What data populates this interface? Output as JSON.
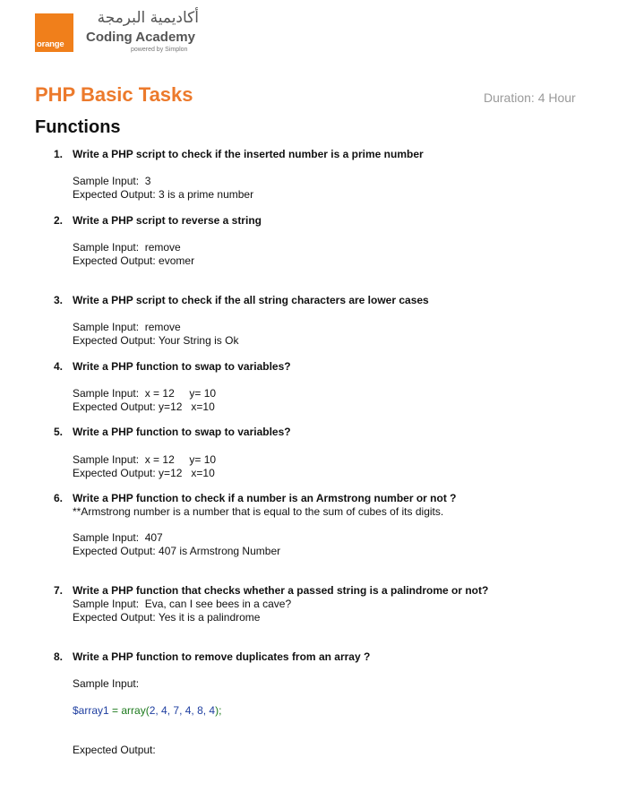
{
  "logo": {
    "badge_text": "orange",
    "arabic_name": "أكاديمية البرمجة",
    "english_name": "Coding Academy",
    "powered_by": "powered by Simplon"
  },
  "header": {
    "title": "PHP Basic Tasks",
    "duration": "Duration: 4 Hour"
  },
  "section_title": "Functions",
  "tasks": [
    {
      "num": "1.",
      "question": "Write a PHP script to check if the inserted number is a prime number",
      "input": "Sample Input:  3",
      "output": "Expected Output: 3 is a prime number"
    },
    {
      "num": "2.",
      "question": "Write a PHP script to reverse a string",
      "input": "Sample Input:  remove",
      "output": "Expected Output: evomer"
    },
    {
      "num": "3.",
      "question": " Write a PHP script to check if the all string characters are lower cases",
      "input": "Sample Input:  remove",
      "output": "Expected Output: Your String is Ok"
    },
    {
      "num": "4.",
      "question": "Write a PHP function to swap to variables?",
      "input": "Sample Input:  x = 12     y= 10",
      "output": "Expected Output: y=12   x=10"
    },
    {
      "num": "5.",
      "question": "Write a PHP function to swap to variables?",
      "input": "Sample Input:  x = 12     y= 10",
      "output": "Expected Output: y=12   x=10"
    },
    {
      "num": "6.",
      "question": "Write a PHP function to check if a number is an Armstrong number or not ?",
      "note": "**Armstrong number is a number that is equal to the sum of cubes of its digits.",
      "input": "Sample Input:  407",
      "output": "Expected Output: 407 is Armstrong Number"
    },
    {
      "num": "7.",
      "question": "Write a PHP function that checks whether a passed string is a palindrome or not?",
      "input": "Sample Input:  Eva, can I see bees in a cave?",
      "output": "Expected Output: Yes it is a palindrome"
    },
    {
      "num": "8.",
      "question": "Write a PHP function to remove duplicates from an array ?",
      "input": "Sample Input:",
      "code_var": "$array1",
      "code_eq": " = ",
      "code_func": "array(",
      "code_args": "2, 4, 7, 4, 8, 4",
      "code_end": ");",
      "output": "Expected Output:"
    }
  ],
  "colors": {
    "title": "#ec7a2c",
    "logo_orange": "#f07f1b",
    "code_blue": "#1f3fa0",
    "code_green": "#1e7a1e"
  }
}
